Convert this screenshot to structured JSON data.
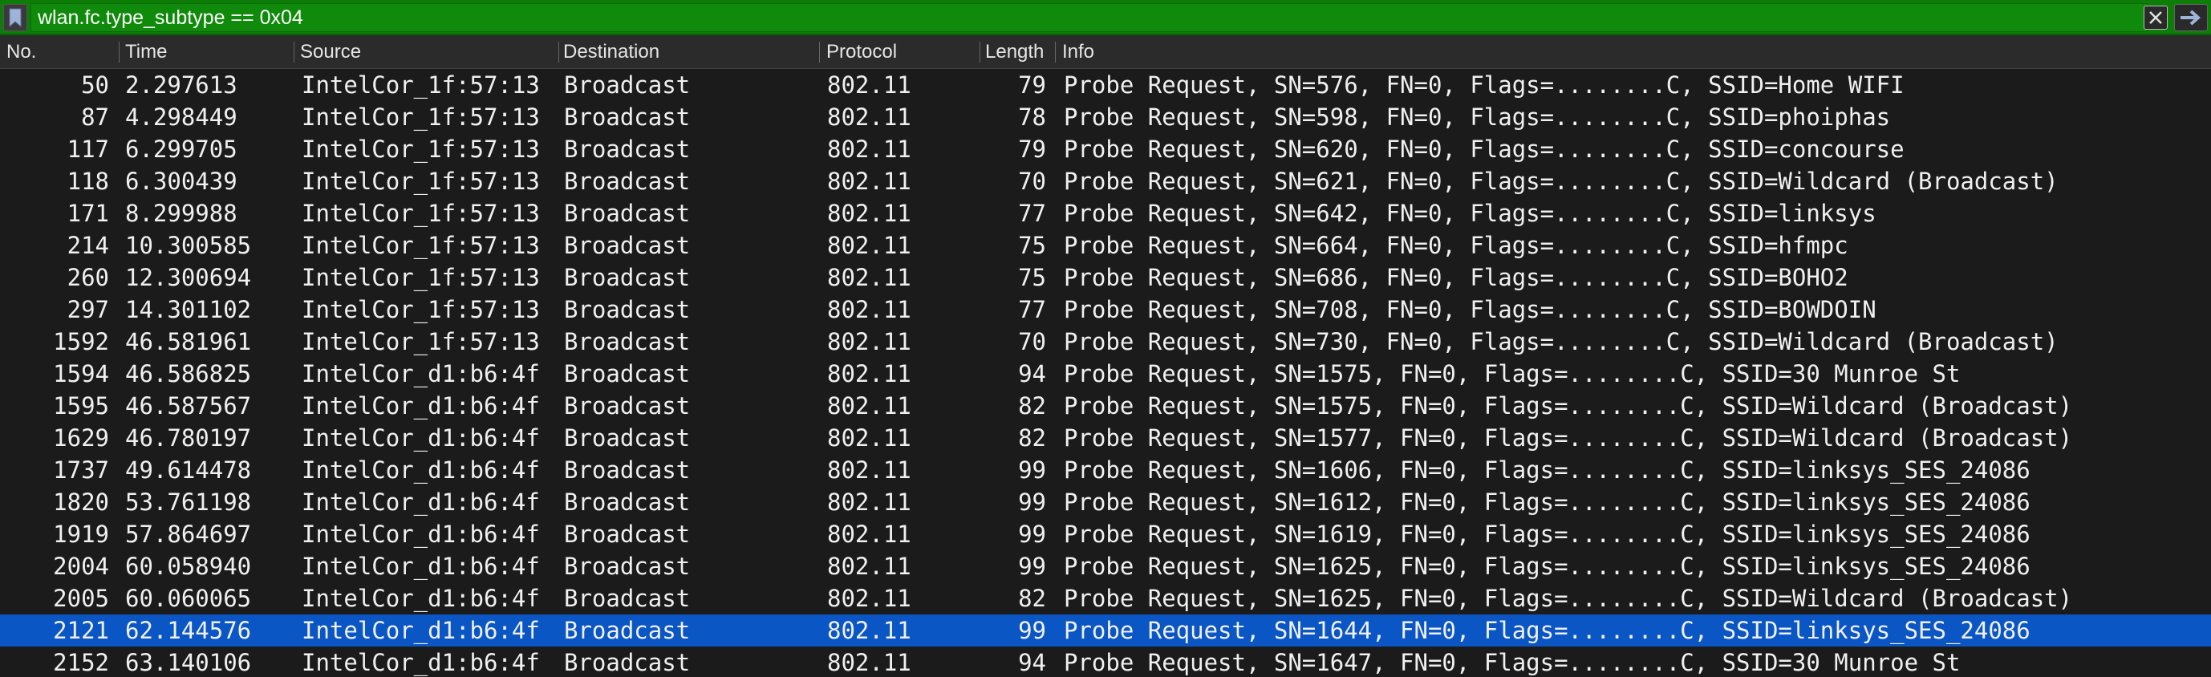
{
  "filter": {
    "value": "wlan.fc.type_subtype == 0x04"
  },
  "columns": {
    "no": "No.",
    "time": "Time",
    "source": "Source",
    "destination": "Destination",
    "protocol": "Protocol",
    "length": "Length",
    "info": "Info"
  },
  "packets": [
    {
      "no": "50",
      "time": "2.297613",
      "source": "IntelCor_1f:57:13",
      "destination": "Broadcast",
      "protocol": "802.11",
      "length": "79",
      "info": "Probe Request, SN=576, FN=0, Flags=........C, SSID=Home WIFI"
    },
    {
      "no": "87",
      "time": "4.298449",
      "source": "IntelCor_1f:57:13",
      "destination": "Broadcast",
      "protocol": "802.11",
      "length": "78",
      "info": "Probe Request, SN=598, FN=0, Flags=........C, SSID=phoiphas"
    },
    {
      "no": "117",
      "time": "6.299705",
      "source": "IntelCor_1f:57:13",
      "destination": "Broadcast",
      "protocol": "802.11",
      "length": "79",
      "info": "Probe Request, SN=620, FN=0, Flags=........C, SSID=concourse"
    },
    {
      "no": "118",
      "time": "6.300439",
      "source": "IntelCor_1f:57:13",
      "destination": "Broadcast",
      "protocol": "802.11",
      "length": "70",
      "info": "Probe Request, SN=621, FN=0, Flags=........C, SSID=Wildcard (Broadcast)"
    },
    {
      "no": "171",
      "time": "8.299988",
      "source": "IntelCor_1f:57:13",
      "destination": "Broadcast",
      "protocol": "802.11",
      "length": "77",
      "info": "Probe Request, SN=642, FN=0, Flags=........C, SSID=linksys"
    },
    {
      "no": "214",
      "time": "10.300585",
      "source": "IntelCor_1f:57:13",
      "destination": "Broadcast",
      "protocol": "802.11",
      "length": "75",
      "info": "Probe Request, SN=664, FN=0, Flags=........C, SSID=hfmpc"
    },
    {
      "no": "260",
      "time": "12.300694",
      "source": "IntelCor_1f:57:13",
      "destination": "Broadcast",
      "protocol": "802.11",
      "length": "75",
      "info": "Probe Request, SN=686, FN=0, Flags=........C, SSID=BOHO2"
    },
    {
      "no": "297",
      "time": "14.301102",
      "source": "IntelCor_1f:57:13",
      "destination": "Broadcast",
      "protocol": "802.11",
      "length": "77",
      "info": "Probe Request, SN=708, FN=0, Flags=........C, SSID=BOWDOIN"
    },
    {
      "no": "1592",
      "time": "46.581961",
      "source": "IntelCor_1f:57:13",
      "destination": "Broadcast",
      "protocol": "802.11",
      "length": "70",
      "info": "Probe Request, SN=730, FN=0, Flags=........C, SSID=Wildcard (Broadcast)"
    },
    {
      "no": "1594",
      "time": "46.586825",
      "source": "IntelCor_d1:b6:4f",
      "destination": "Broadcast",
      "protocol": "802.11",
      "length": "94",
      "info": "Probe Request, SN=1575, FN=0, Flags=........C, SSID=30 Munroe St"
    },
    {
      "no": "1595",
      "time": "46.587567",
      "source": "IntelCor_d1:b6:4f",
      "destination": "Broadcast",
      "protocol": "802.11",
      "length": "82",
      "info": "Probe Request, SN=1575, FN=0, Flags=........C, SSID=Wildcard (Broadcast)"
    },
    {
      "no": "1629",
      "time": "46.780197",
      "source": "IntelCor_d1:b6:4f",
      "destination": "Broadcast",
      "protocol": "802.11",
      "length": "82",
      "info": "Probe Request, SN=1577, FN=0, Flags=........C, SSID=Wildcard (Broadcast)"
    },
    {
      "no": "1737",
      "time": "49.614478",
      "source": "IntelCor_d1:b6:4f",
      "destination": "Broadcast",
      "protocol": "802.11",
      "length": "99",
      "info": "Probe Request, SN=1606, FN=0, Flags=........C, SSID=linksys_SES_24086"
    },
    {
      "no": "1820",
      "time": "53.761198",
      "source": "IntelCor_d1:b6:4f",
      "destination": "Broadcast",
      "protocol": "802.11",
      "length": "99",
      "info": "Probe Request, SN=1612, FN=0, Flags=........C, SSID=linksys_SES_24086"
    },
    {
      "no": "1919",
      "time": "57.864697",
      "source": "IntelCor_d1:b6:4f",
      "destination": "Broadcast",
      "protocol": "802.11",
      "length": "99",
      "info": "Probe Request, SN=1619, FN=0, Flags=........C, SSID=linksys_SES_24086"
    },
    {
      "no": "2004",
      "time": "60.058940",
      "source": "IntelCor_d1:b6:4f",
      "destination": "Broadcast",
      "protocol": "802.11",
      "length": "99",
      "info": "Probe Request, SN=1625, FN=0, Flags=........C, SSID=linksys_SES_24086"
    },
    {
      "no": "2005",
      "time": "60.060065",
      "source": "IntelCor_d1:b6:4f",
      "destination": "Broadcast",
      "protocol": "802.11",
      "length": "82",
      "info": "Probe Request, SN=1625, FN=0, Flags=........C, SSID=Wildcard (Broadcast)"
    },
    {
      "no": "2121",
      "time": "62.144576",
      "source": "IntelCor_d1:b6:4f",
      "destination": "Broadcast",
      "protocol": "802.11",
      "length": "99",
      "info": "Probe Request, SN=1644, FN=0, Flags=........C, SSID=linksys_SES_24086",
      "selected": true
    },
    {
      "no": "2152",
      "time": "63.140106",
      "source": "IntelCor_d1:b6:4f",
      "destination": "Broadcast",
      "protocol": "802.11",
      "length": "94",
      "info": "Probe Request, SN=1647, FN=0, Flags=........C, SSID=30 Munroe St"
    }
  ],
  "colors": {
    "filter_valid_bg": "#0d7d08",
    "selected_row_bg": "#0a56c4",
    "list_bg": "#1b1b1b"
  },
  "icons": {
    "bookmark": "bookmark-icon",
    "clear": "clear-filter-icon",
    "apply": "apply-arrow-icon"
  }
}
